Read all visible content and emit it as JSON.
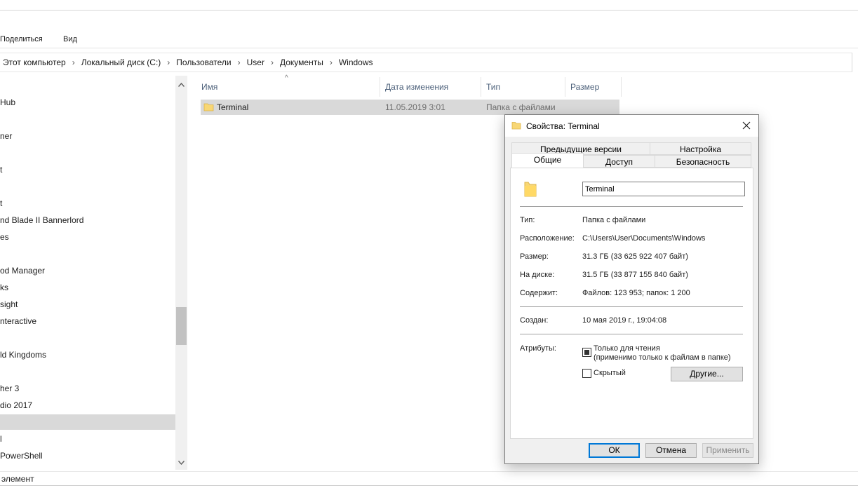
{
  "ribbon": {
    "tabs": [
      "Поделиться",
      "Вид"
    ]
  },
  "breadcrumb": [
    "Этот компьютер",
    "Локальный диск (C:)",
    "Пользователи",
    "User",
    "Документы",
    "Windows"
  ],
  "nav": {
    "items": [
      "Hub",
      "ner",
      "t",
      "t",
      "nd Blade II Bannerlord",
      "es",
      "od Manager",
      "ks",
      "sight",
      "nteractive",
      "ld Kingdoms",
      "her 3",
      "dio 2017",
      "",
      "l",
      "PowerShell"
    ],
    "selected_index": 13
  },
  "file_list": {
    "columns": [
      "Имя",
      "Дата изменения",
      "Тип",
      "Размер"
    ],
    "rows": [
      {
        "name": "Terminal",
        "date": "11.05.2019 3:01",
        "type": "Папка с файлами",
        "size": ""
      }
    ]
  },
  "status": {
    "text": "элемент"
  },
  "dialog": {
    "title": "Свойства: Terminal",
    "tabs_row1": [
      "Предыдущие версии",
      "Настройка"
    ],
    "tabs_row2": [
      "Общие",
      "Доступ",
      "Безопасность"
    ],
    "active_tab": "Общие",
    "name_value": "Terminal",
    "props": {
      "type_label": "Тип:",
      "type_value": "Папка с файлами",
      "location_label": "Расположение:",
      "location_value": "C:\\Users\\User\\Documents\\Windows",
      "size_label": "Размер:",
      "size_value": "31.3 ГБ (33 625 922 407 байт)",
      "disk_label": "На диске:",
      "disk_value": "31.5 ГБ (33 877 155 840 байт)",
      "contains_label": "Содержит:",
      "contains_value": "Файлов: 123 953; папок: 1 200",
      "created_label": "Создан:",
      "created_value": "10 мая 2019 г., 19:04:08",
      "attributes_label": "Атрибуты:"
    },
    "readonly_label": "Только для чтения",
    "readonly_note": "(применимо только к файлам в папке)",
    "readonly_state": "indeterminate",
    "hidden_label": "Скрытый",
    "hidden_checked": false,
    "other_button": "Другие...",
    "ok": "ОК",
    "cancel": "Отмена",
    "apply": "Применить"
  }
}
